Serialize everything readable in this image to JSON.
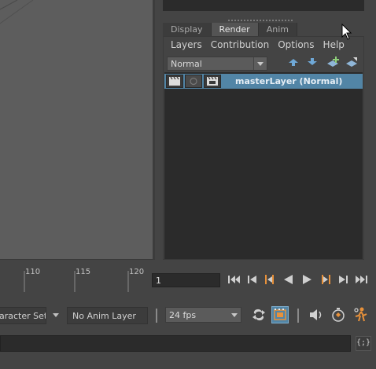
{
  "tabs": [
    {
      "label": "Display"
    },
    {
      "label": "Render"
    },
    {
      "label": "Anim"
    }
  ],
  "menu": [
    "Layers",
    "Contribution",
    "Options",
    "Help"
  ],
  "blend_mode": {
    "value": "Normal"
  },
  "layer": {
    "name": "masterLayer (Normal)"
  },
  "timeline": {
    "ticks": [
      "110",
      "115",
      "120"
    ],
    "current_frame": "1"
  },
  "bottom": {
    "character_set": "aracter Set",
    "anim_layer": "No Anim Layer",
    "fps": "24 fps",
    "cmd_button": "{;}"
  },
  "colors": {
    "selection": "#5285a6",
    "accent_orange": "#e8913a"
  }
}
